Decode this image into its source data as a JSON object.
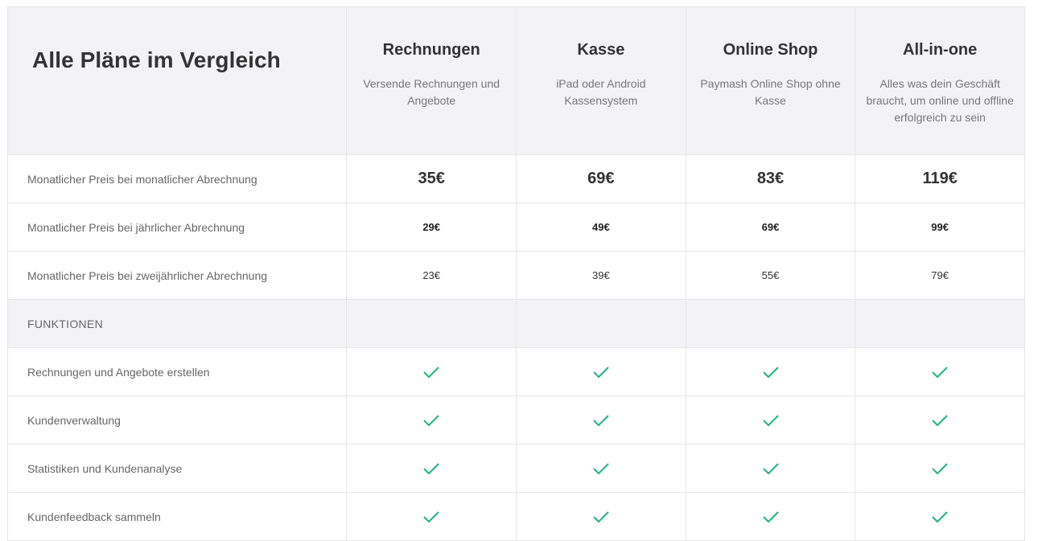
{
  "header": {
    "title": "Alle Pläne im Vergleich",
    "plans": [
      {
        "name": "Rechnungen",
        "description": "Versende Rechnungen und Angebote"
      },
      {
        "name": "Kasse",
        "description": "iPad oder Android Kassensystem"
      },
      {
        "name": "Online Shop",
        "description": "Paymash Online Shop ohne Kasse"
      },
      {
        "name": "All-in-one",
        "description": "Alles was dein Geschäft braucht, um online und offline erfolgreich zu sein"
      }
    ]
  },
  "pricing": [
    {
      "label": "Monatlicher Preis bei monatlicher Abrechnung",
      "values": [
        "35€",
        "69€",
        "83€",
        "119€"
      ]
    },
    {
      "label": "Monatlicher Preis bei jährlicher Abrechnung",
      "values": [
        "29€",
        "49€",
        "69€",
        "99€"
      ]
    },
    {
      "label": "Monatlicher Preis bei zweijährlicher Abrechnung",
      "values": [
        "23€",
        "39€",
        "55€",
        "79€"
      ]
    }
  ],
  "features_section": {
    "label": "FUNKTIONEN"
  },
  "features": [
    {
      "label": "Rechnungen und Angebote erstellen",
      "included": [
        true,
        true,
        true,
        true
      ]
    },
    {
      "label": "Kundenverwaltung",
      "included": [
        true,
        true,
        true,
        true
      ]
    },
    {
      "label": "Statistiken und Kundenanalyse",
      "included": [
        true,
        true,
        true,
        true
      ]
    },
    {
      "label": "Kundenfeedback sammeln",
      "included": [
        true,
        true,
        true,
        true
      ]
    }
  ],
  "colors": {
    "check": "#1fb47a",
    "header_bg": "#f3f3f6",
    "border": "#e6e6e6"
  },
  "icons": {
    "included": "check-icon"
  }
}
